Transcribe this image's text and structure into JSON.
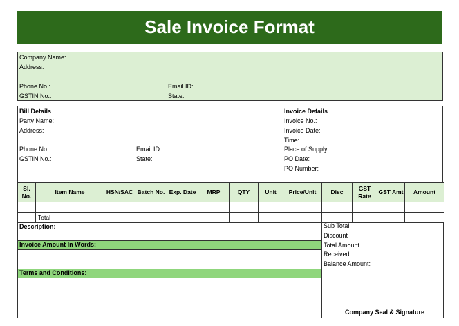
{
  "title": "Sale Invoice Format",
  "company": {
    "name_label": "Company Name:",
    "address_label": "Address:",
    "phone_label": "Phone No.:",
    "gstin_label": "GSTIN No.:",
    "email_label": "Email ID:",
    "state_label": "State:"
  },
  "bill": {
    "heading": "Bill Details",
    "party_label": "Party Name:",
    "address_label": "Address:",
    "phone_label": "Phone No.:",
    "gstin_label": "GSTIN No.:",
    "email_label": "Email ID:",
    "state_label": "State:"
  },
  "invoice": {
    "heading": "Invoice Details",
    "fields": [
      "Invoice No.:",
      "Invoice Date:",
      "Time:",
      "Place of Supply:",
      "PO Date:",
      "PO Number:"
    ]
  },
  "table": {
    "headers": [
      "Sl. No.",
      "Item Name",
      "HSN/SAC",
      "Batch No.",
      "Exp. Date",
      "MRP",
      "QTY",
      "Unit",
      "Price/Unit",
      "Disc",
      "GST Rate",
      "GST Amt",
      "Amount"
    ],
    "total_label": "Total"
  },
  "footer": {
    "description_label": "Description:",
    "words_label": "Invoice Amount In Words:",
    "terms_label": "Terms and Conditions:",
    "summary": [
      "Sub Total",
      "Discount",
      "Total Amount",
      "Received",
      "Balance Amount:"
    ],
    "seal_label": "Company Seal & Signature"
  },
  "colors": {
    "title_bg": "#2d6a1b",
    "light_green": "#dcefd3",
    "strip_green": "#8fd67c"
  }
}
